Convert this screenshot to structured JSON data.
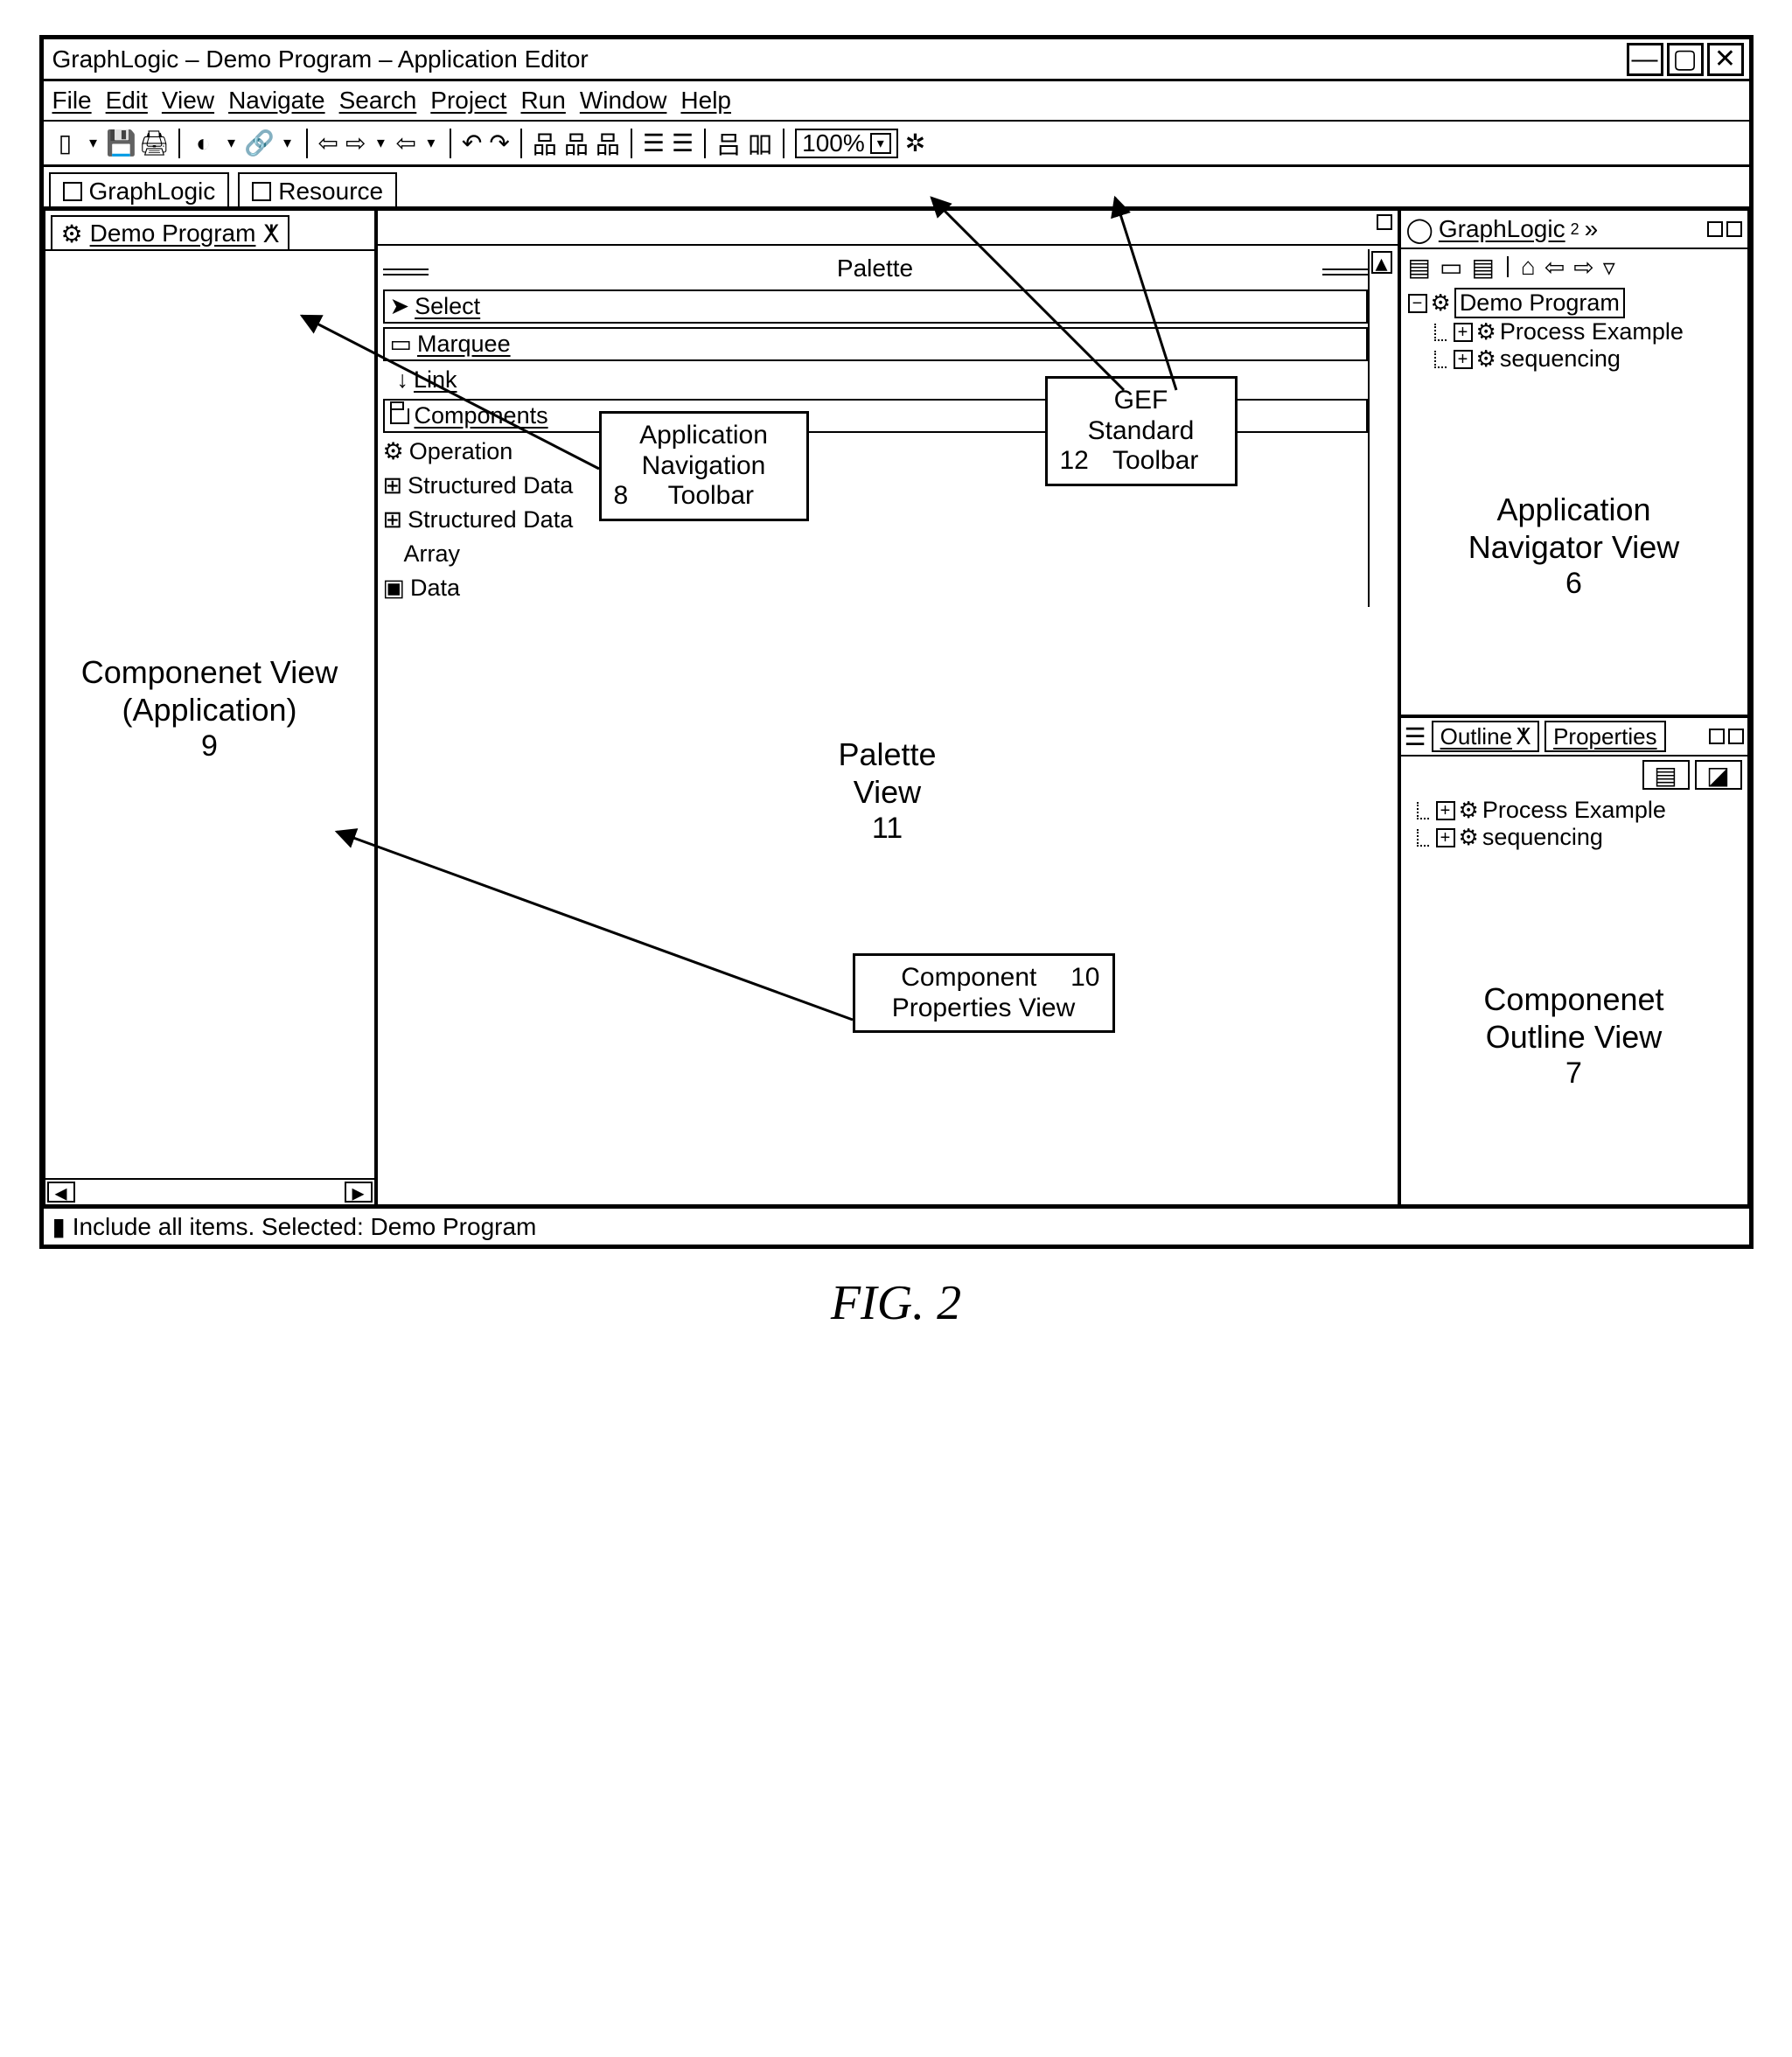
{
  "figure_label": "FIG. 2",
  "window": {
    "title": "GraphLogic – Demo Program – Application Editor"
  },
  "menu": {
    "items": [
      "File",
      "Edit",
      "View",
      "Navigate",
      "Search",
      "Project",
      "Run",
      "Window",
      "Help"
    ]
  },
  "toolbar": {
    "zoom": "100%"
  },
  "perspectives": {
    "tabs": [
      {
        "label": "GraphLogic"
      },
      {
        "label": "Resource"
      }
    ]
  },
  "navigator": {
    "tab_label": "GraphLogic",
    "super": "2",
    "root": "Demo Program",
    "children": [
      "Process Example",
      "sequencing"
    ],
    "big_label_l1": "Application",
    "big_label_l2": "Navigator View",
    "ref": "6"
  },
  "outline": {
    "tabs": [
      "Outline",
      "Properties"
    ],
    "items": [
      "Process Example",
      "sequencing"
    ],
    "big_label_l1": "Componenet",
    "big_label_l2": "Outline View",
    "ref": "7"
  },
  "editor": {
    "tab_label": "Demo Program",
    "big_label_l1": "Componenet View",
    "big_label_l2": "(Application)",
    "ref": "9"
  },
  "palette": {
    "title": "Palette",
    "tools": {
      "select": "Select",
      "marquee": "Marquee",
      "link": "Link",
      "drawer": "Components",
      "op": "Operation",
      "sd1": "Structured Data",
      "sd2": "Structured Data",
      "array": "Array",
      "data": "Data"
    },
    "big_label_l1": "Palette",
    "big_label_l2": "View",
    "ref": "11"
  },
  "callouts": {
    "nav_toolbar": {
      "l1": "Application",
      "l2": "Navigation",
      "l3": "Toolbar",
      "ref": "8"
    },
    "gef_toolbar": {
      "l1": "GEF",
      "l2": "Standard",
      "l3": "Toolbar",
      "ref": "12"
    },
    "comp_props": {
      "l1": "Component",
      "l2": "Properties View",
      "ref": "10"
    }
  },
  "status": {
    "text": "Include all items. Selected: Demo Program"
  }
}
